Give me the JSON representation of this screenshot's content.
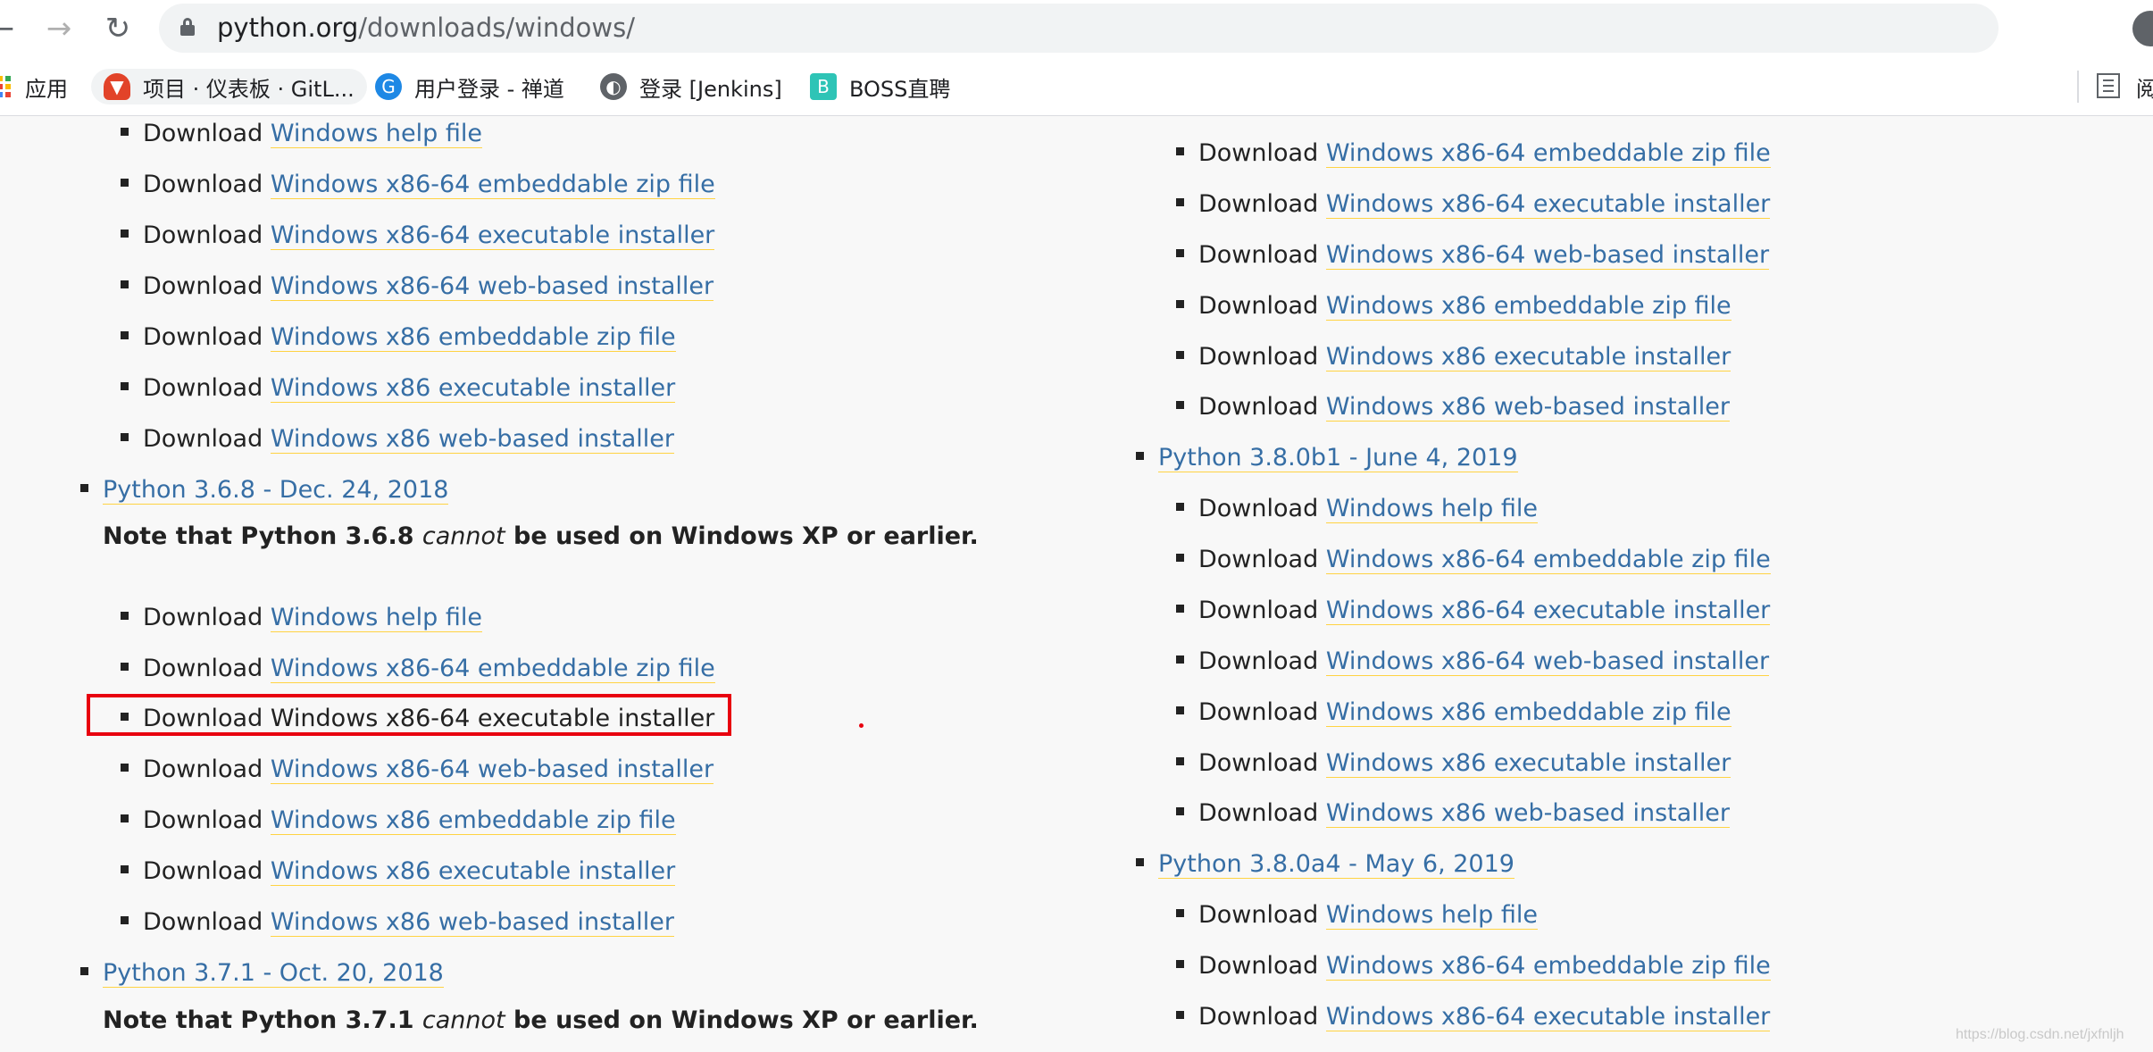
{
  "browser": {
    "url_host": "python.org",
    "url_path": "/downloads/windows/"
  },
  "bookmarks": [
    {
      "label": "应用"
    },
    {
      "label": "项目 · 仪表板 · GitL..."
    },
    {
      "label": "用户登录 - 禅道"
    },
    {
      "label": "登录 [Jenkins]"
    },
    {
      "label": "BOSS直聘"
    }
  ],
  "bookmarks_extra": {
    "reading_list_label": "阅"
  },
  "left_column": {
    "block1": [
      {
        "prefix": "Download",
        "link": "Windows help file"
      },
      {
        "prefix": "Download",
        "link": "Windows x86-64 embeddable zip file"
      },
      {
        "prefix": "Download",
        "link": "Windows x86-64 executable installer"
      },
      {
        "prefix": "Download",
        "link": "Windows x86-64 web-based installer"
      },
      {
        "prefix": "Download",
        "link": "Windows x86 embeddable zip file"
      },
      {
        "prefix": "Download",
        "link": "Windows x86 executable installer"
      },
      {
        "prefix": "Download",
        "link": "Windows x86 web-based installer"
      }
    ],
    "release1": {
      "title": "Python 3.6.8 - Dec. 24, 2018",
      "note_before": "Note that Python 3.6.8 ",
      "note_em": "cannot",
      "note_after": " be used on Windows XP or earlier."
    },
    "block2": [
      {
        "prefix": "Download",
        "link": "Windows help file"
      },
      {
        "prefix": "Download",
        "link": "Windows x86-64 embeddable zip file"
      },
      {
        "prefix": "Download",
        "link": "Windows x86-64 executable installer"
      },
      {
        "prefix": "Download",
        "link": "Windows x86-64 web-based installer"
      },
      {
        "prefix": "Download",
        "link": "Windows x86 embeddable zip file"
      },
      {
        "prefix": "Download",
        "link": "Windows x86 executable installer"
      },
      {
        "prefix": "Download",
        "link": "Windows x86 web-based installer"
      }
    ],
    "release2": {
      "title": "Python 3.7.1 - Oct. 20, 2018",
      "note_before": "Note that Python 3.7.1 ",
      "note_em": "cannot",
      "note_after": " be used on Windows XP or earlier."
    }
  },
  "right_column": {
    "block1": [
      {
        "prefix": "Download",
        "link": "Windows x86-64 embeddable zip file"
      },
      {
        "prefix": "Download",
        "link": "Windows x86-64 executable installer"
      },
      {
        "prefix": "Download",
        "link": "Windows x86-64 web-based installer"
      },
      {
        "prefix": "Download",
        "link": "Windows x86 embeddable zip file"
      },
      {
        "prefix": "Download",
        "link": "Windows x86 executable installer"
      },
      {
        "prefix": "Download",
        "link": "Windows x86 web-based installer"
      }
    ],
    "release1": {
      "title": "Python 3.8.0b1 - June 4, 2019"
    },
    "block2": [
      {
        "prefix": "Download",
        "link": "Windows help file"
      },
      {
        "prefix": "Download",
        "link": "Windows x86-64 embeddable zip file"
      },
      {
        "prefix": "Download",
        "link": "Windows x86-64 executable installer"
      },
      {
        "prefix": "Download",
        "link": "Windows x86-64 web-based installer"
      },
      {
        "prefix": "Download",
        "link": "Windows x86 embeddable zip file"
      },
      {
        "prefix": "Download",
        "link": "Windows x86 executable installer"
      },
      {
        "prefix": "Download",
        "link": "Windows x86 web-based installer"
      }
    ],
    "release2": {
      "title": "Python 3.8.0a4 - May 6, 2019"
    },
    "block3": [
      {
        "prefix": "Download",
        "link": "Windows help file"
      },
      {
        "prefix": "Download",
        "link": "Windows x86-64 embeddable zip file"
      },
      {
        "prefix": "Download",
        "link": "Windows x86-64 executable installer"
      }
    ]
  },
  "watermark": "https://blog.csdn.net/jxfnljh",
  "colors": {
    "link": "#366ea5",
    "link_underline": "#ffd343",
    "highlight": "#e8000f"
  }
}
